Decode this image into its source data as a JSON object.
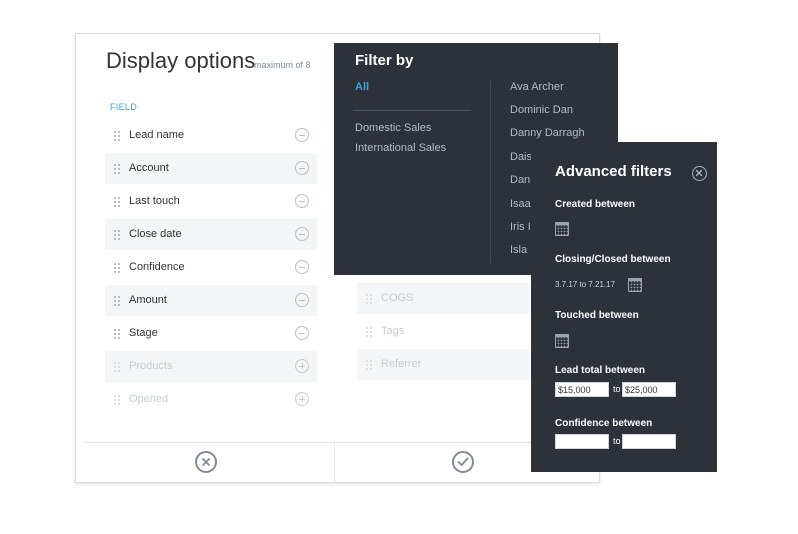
{
  "display_options": {
    "title": "Display options",
    "subtitle": "maximum of 8",
    "field_header": "FIELD",
    "fields": [
      {
        "label": "Lead name",
        "state": "selected"
      },
      {
        "label": "Account",
        "state": "selected"
      },
      {
        "label": "Last touch",
        "state": "selected"
      },
      {
        "label": "Close date",
        "state": "selected"
      },
      {
        "label": "Confidence",
        "state": "selected"
      },
      {
        "label": "Amount",
        "state": "selected"
      },
      {
        "label": "Stage",
        "state": "selected"
      },
      {
        "label": "Products",
        "state": "available"
      },
      {
        "label": "Opened",
        "state": "available"
      }
    ],
    "available_fields": [
      "COGS",
      "Tags",
      "Referrer"
    ]
  },
  "filter_by": {
    "title": "Filter by",
    "all_label": "All",
    "groups": [
      "Domestic Sales",
      "International Sales"
    ],
    "people": [
      "Ava Archer",
      "Dominic Dan",
      "Danny Darragh",
      "Dais",
      "Dan",
      "Isaa",
      "Iris I",
      "Isla"
    ]
  },
  "advanced_filters": {
    "title": "Advanced filters",
    "created_label": "Created between",
    "closing_label": "Closing/Closed between",
    "closing_range": "3.7.17 to 7.21.17",
    "touched_label": "Touched between",
    "lead_total_label": "Lead total between",
    "lead_total_min": "$15,000",
    "lead_total_max": "$25,000",
    "to_label": "to",
    "confidence_label": "Confidence between",
    "confidence_min": "",
    "confidence_max": ""
  },
  "colors": {
    "accent": "#3fa3d8",
    "dark_panel": "#2d323a"
  }
}
